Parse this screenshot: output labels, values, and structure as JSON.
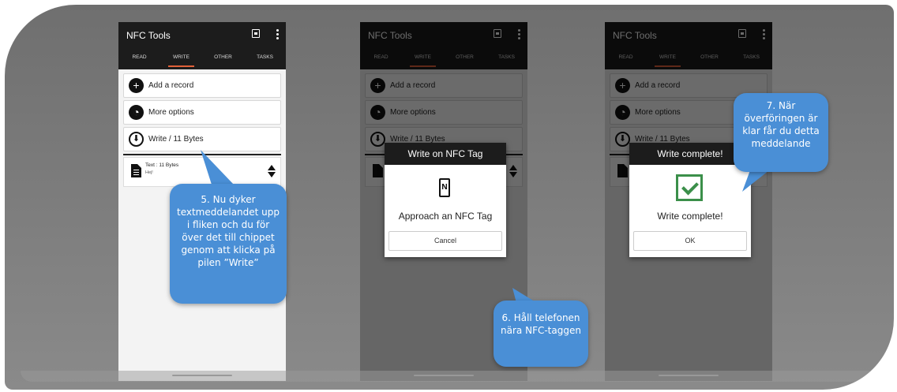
{
  "app": {
    "title": "NFC Tools",
    "tabs": [
      "READ",
      "WRITE",
      "OTHER",
      "TASKS"
    ],
    "icons": [
      "calendar-icon",
      "more-vert-icon"
    ]
  },
  "cards": {
    "add_record": "Add a record",
    "more_options": "More options",
    "write": "Write / 11 Bytes"
  },
  "record": {
    "type": "Text : 11 Bytes",
    "value": "Hej!"
  },
  "dialog_approach": {
    "title": "Write on NFC Tag",
    "message": "Approach an NFC Tag",
    "button": "Cancel"
  },
  "dialog_complete": {
    "title": "Write complete!",
    "message": "Write complete!",
    "button": "OK"
  },
  "callouts": {
    "step5": "5. Nu dyker textmeddelandet upp i fliken och du för över det till chippet genom att klicka på pilen ”Write”",
    "step6": "6. Håll telefonen nära NFC-taggen",
    "step7": "7. När överföringen är klar får du detta meddelande"
  },
  "colors": {
    "accent": "#e0613a",
    "callout": "#4a8fd6",
    "success": "#3b8f4a"
  }
}
